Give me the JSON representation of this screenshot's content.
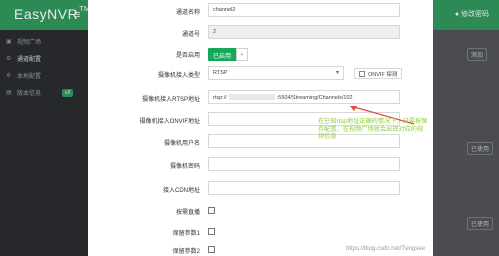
{
  "app": {
    "brand": "EasyNVR",
    "brand_mark": "TM",
    "hamburger": "≡",
    "change_password": "● 修改密码"
  },
  "sidebar": {
    "items": [
      {
        "label": "视频广场",
        "icon": "play-icon",
        "glyph": "▣"
      },
      {
        "label": "通道配置",
        "icon": "settings-icon",
        "glyph": "⚙",
        "active": true
      },
      {
        "label": "本地配置",
        "icon": "gear-icon",
        "glyph": "✲"
      },
      {
        "label": "版本信息",
        "icon": "info-icon",
        "glyph": "▤",
        "badge": "v3"
      }
    ]
  },
  "right_bg": {
    "top_btn": "添加",
    "row1": "已使用",
    "row2": "已使用"
  },
  "form": {
    "channel_name": {
      "label": "通道名称",
      "value": "channel2"
    },
    "channel_no": {
      "label": "通道号",
      "value": "2"
    },
    "enabled": {
      "label": "是否启用",
      "on_text": "已启用",
      "knob": "‹"
    },
    "access_type": {
      "label": "摄像机接入类型",
      "value": "RTSP",
      "onvif_label": "ONVIF 探测"
    },
    "rtsp_url": {
      "label": "摄像机接入RTSP地址",
      "prefix": "rtsp://",
      "suffix": ":5504/Streaming/Channels/102"
    },
    "onvif_url": {
      "label": "摄像机接入ONVIF地址",
      "value": ""
    },
    "username": {
      "label": "摄像机用户名",
      "value": ""
    },
    "password": {
      "label": "摄像机密码",
      "value": ""
    },
    "cdn_url": {
      "label": "接入CDN地址",
      "value": ""
    },
    "ondemand": {
      "label": "按需直播"
    },
    "reserve1": {
      "label": "保留参数1"
    },
    "reserve2": {
      "label": "保留参数2"
    }
  },
  "annotation": "在已知rtsp地址正确的情况下，只要按保存配置，在视频广场就会出现对应的视频信息",
  "watermark": "https://blog.csdn.net/Tsingsee"
}
